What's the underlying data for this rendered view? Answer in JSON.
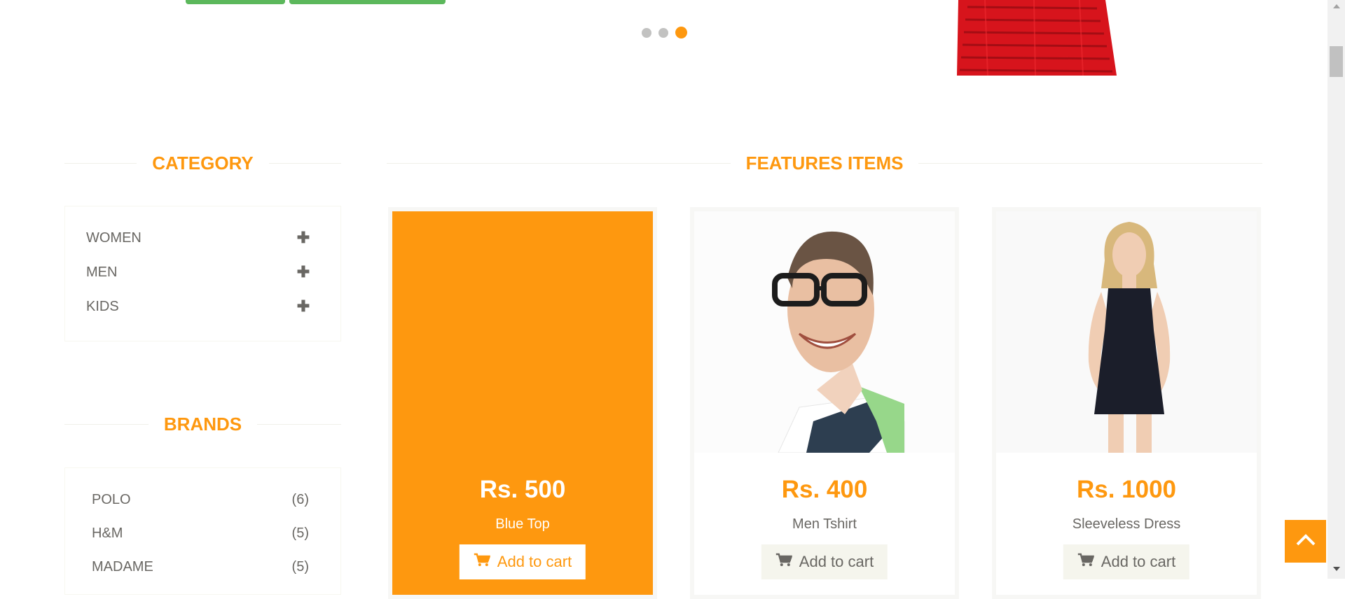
{
  "slider": {
    "dots": [
      {
        "active": false
      },
      {
        "active": false
      },
      {
        "active": true
      }
    ]
  },
  "category": {
    "title": "CATEGORY",
    "items": [
      {
        "label": "WOMEN",
        "icon": "plus-icon"
      },
      {
        "label": "MEN",
        "icon": "plus-icon"
      },
      {
        "label": "KIDS",
        "icon": "plus-icon"
      }
    ]
  },
  "brands": {
    "title": "BRANDS",
    "items": [
      {
        "name": "POLO",
        "count": "(6)"
      },
      {
        "name": "H&M",
        "count": "(5)"
      },
      {
        "name": "MADAME",
        "count": "(5)"
      }
    ]
  },
  "features": {
    "title": "FEATURES ITEMS",
    "products": [
      {
        "price": "Rs. 500",
        "name": "Blue Top",
        "button": "Add to cart",
        "state": "hover-overlay"
      },
      {
        "price": "Rs. 400",
        "name": "Men Tshirt",
        "button": "Add to cart"
      },
      {
        "price": "Rs. 1000",
        "name": "Sleeveless Dress",
        "button": "Add to cart"
      }
    ]
  },
  "icons": {
    "cart": "shopping-cart-icon",
    "scroll_top": "chevron-up-icon",
    "expand": "plus-icon"
  },
  "colors": {
    "accent": "#fe980f",
    "text": "#696763",
    "button_bg": "#f5f5ed",
    "slider_button": "#5cb85c"
  }
}
